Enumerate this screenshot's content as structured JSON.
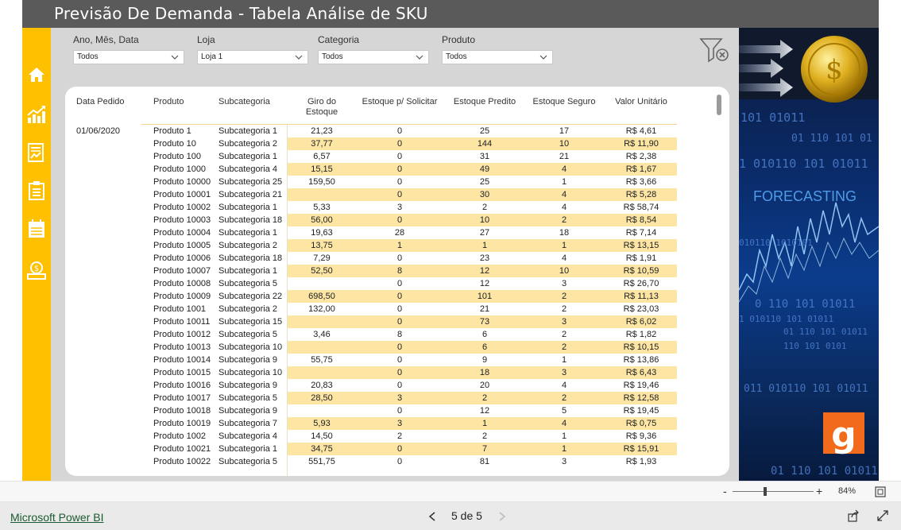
{
  "header": {
    "title": "Previsão De Demanda - Tabela Análise de SKU"
  },
  "nav": {
    "items": [
      {
        "icon": "home-icon"
      },
      {
        "icon": "chart-icon"
      },
      {
        "icon": "report-icon"
      },
      {
        "icon": "clipboard-icon"
      },
      {
        "icon": "calendar-icon"
      },
      {
        "icon": "money-icon"
      }
    ]
  },
  "filters": [
    {
      "label": "Ano, Mês, Data",
      "value": "Todos"
    },
    {
      "label": "Loja",
      "value": "Loja 1"
    },
    {
      "label": "Categoria",
      "value": "Todos"
    },
    {
      "label": "Produto",
      "value": "Todos"
    }
  ],
  "table": {
    "columns": [
      "Data Pedido",
      "Produto",
      "Subcategoria",
      "Giro do Estoque",
      "Estoque p/ Solicitar",
      "Estoque Predito",
      "Estoque Seguro",
      "Valor Unitário"
    ],
    "column_lines": [
      [
        "Data Pedido"
      ],
      [
        "Produto"
      ],
      [
        "Subcategoria"
      ],
      [
        "Giro do",
        "Estoque"
      ],
      [
        "Estoque p/ Solicitar"
      ],
      [
        "Estoque Predito"
      ],
      [
        "Estoque Seguro"
      ],
      [
        "Valor Unitário"
      ]
    ],
    "rows": [
      [
        "01/06/2020",
        "Produto 1",
        "Subcategoria 1",
        "21,23",
        "0",
        "25",
        "17",
        "R$ 4,61"
      ],
      [
        "",
        "Produto 10",
        "Subcategoria 2",
        "37,77",
        "0",
        "144",
        "10",
        "R$ 11,90"
      ],
      [
        "",
        "Produto 100",
        "Subcategoria 1",
        "6,57",
        "0",
        "31",
        "21",
        "R$ 2,38"
      ],
      [
        "",
        "Produto 1000",
        "Subcategoria 4",
        "15,15",
        "0",
        "49",
        "4",
        "R$ 1,67"
      ],
      [
        "",
        "Produto 10000",
        "Subcategoria 25",
        "159,50",
        "0",
        "25",
        "1",
        "R$ 3,66"
      ],
      [
        "",
        "Produto 10001",
        "Subcategoria 21",
        "",
        "0",
        "30",
        "4",
        "R$ 5,28"
      ],
      [
        "",
        "Produto 10002",
        "Subcategoria 1",
        "5,33",
        "3",
        "2",
        "4",
        "R$ 58,74"
      ],
      [
        "",
        "Produto 10003",
        "Subcategoria 18",
        "56,00",
        "0",
        "10",
        "2",
        "R$ 8,54"
      ],
      [
        "",
        "Produto 10004",
        "Subcategoria 1",
        "19,63",
        "28",
        "27",
        "18",
        "R$ 7,14"
      ],
      [
        "",
        "Produto 10005",
        "Subcategoria 2",
        "13,75",
        "1",
        "1",
        "1",
        "R$ 13,15"
      ],
      [
        "",
        "Produto 10006",
        "Subcategoria 18",
        "7,29",
        "0",
        "23",
        "4",
        "R$ 1,91"
      ],
      [
        "",
        "Produto 10007",
        "Subcategoria 1",
        "52,50",
        "8",
        "12",
        "10",
        "R$ 10,59"
      ],
      [
        "",
        "Produto 10008",
        "Subcategoria 5",
        "",
        "0",
        "12",
        "3",
        "R$ 26,70"
      ],
      [
        "",
        "Produto 10009",
        "Subcategoria 22",
        "698,50",
        "0",
        "101",
        "2",
        "R$ 11,13"
      ],
      [
        "",
        "Produto 1001",
        "Subcategoria 2",
        "132,00",
        "0",
        "21",
        "2",
        "R$ 23,03"
      ],
      [
        "",
        "Produto 10011",
        "Subcategoria 15",
        "",
        "0",
        "73",
        "3",
        "R$ 6,02"
      ],
      [
        "",
        "Produto 10012",
        "Subcategoria 5",
        "3,46",
        "8",
        "6",
        "2",
        "R$ 1,82"
      ],
      [
        "",
        "Produto 10013",
        "Subcategoria 10",
        "",
        "0",
        "6",
        "2",
        "R$ 10,15"
      ],
      [
        "",
        "Produto 10014",
        "Subcategoria 9",
        "55,75",
        "0",
        "9",
        "1",
        "R$ 13,86"
      ],
      [
        "",
        "Produto 10015",
        "Subcategoria 10",
        "",
        "0",
        "18",
        "3",
        "R$ 6,43"
      ],
      [
        "",
        "Produto 10016",
        "Subcategoria 9",
        "20,83",
        "0",
        "20",
        "4",
        "R$ 19,46"
      ],
      [
        "",
        "Produto 10017",
        "Subcategoria 5",
        "28,50",
        "3",
        "2",
        "2",
        "R$ 12,58"
      ],
      [
        "",
        "Produto 10018",
        "Subcategoria 9",
        "",
        "0",
        "12",
        "5",
        "R$ 19,45"
      ],
      [
        "",
        "Produto 10019",
        "Subcategoria 7",
        "5,93",
        "3",
        "1",
        "4",
        "R$ 0,75"
      ],
      [
        "",
        "Produto 1002",
        "Subcategoria 4",
        "14,50",
        "2",
        "2",
        "1",
        "R$ 9,36"
      ],
      [
        "",
        "Produto 10021",
        "Subcategoria 1",
        "34,75",
        "0",
        "7",
        "1",
        "R$ 15,91"
      ],
      [
        "",
        "Produto 10022",
        "Subcategoria 5",
        "551,75",
        "0",
        "81",
        "3",
        "R$ 1,93"
      ]
    ]
  },
  "right_panel": {
    "forecasting_text": "FORECASTING",
    "binary_lines": [
      "101 01011",
      "01 110 101 01",
      "1 010110 101 01011",
      "010110 1010101",
      "0 110 101 01011",
      "1 010110 101 01011",
      "01 110 101 01011",
      "110 101 0101",
      "011 010110 101 01011",
      "01 110 101 01011"
    ]
  },
  "zoom": {
    "value": "84%",
    "minus": "-",
    "plus": "+"
  },
  "footer": {
    "powerbi_link": "Microsoft Power BI",
    "page_indicator": "5 de 5"
  },
  "colors": {
    "header_bg": "#5a5a5a",
    "nav_bg": "#ffc000",
    "row_highlight": "#fde5a4",
    "panel_bg": "#d6d6d6",
    "logo_orange": "#f26a1b"
  }
}
